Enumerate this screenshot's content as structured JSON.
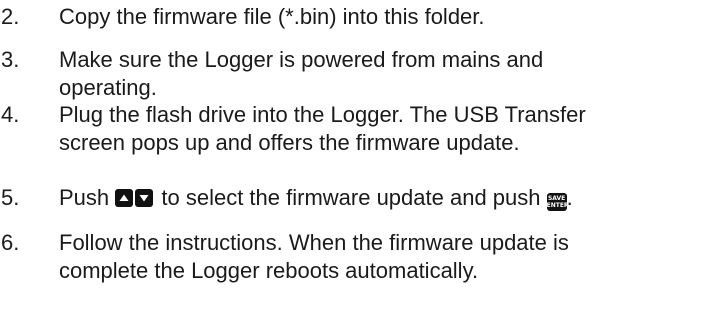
{
  "steps": [
    {
      "number": "2.",
      "lines": [
        "Copy the firmware file (*.bin) into this folder."
      ]
    },
    {
      "number": "3.",
      "lines": [
        "Make sure the Logger is powered from mains and",
        "operating."
      ]
    },
    {
      "number": "4.",
      "lines": [
        "Plug the flash drive into the Logger. The USB Transfer",
        "screen pops up and offers the firmware update."
      ]
    },
    {
      "number": "5.",
      "before": "Push ",
      "middle": " to select the firmware update and push ",
      "after": ".",
      "keys": {
        "up_icon": "up-arrow-key-icon",
        "down_icon": "down-arrow-key-icon",
        "enter_icon": "save-enter-key-icon",
        "enter_top": "SAVE",
        "enter_bottom": "ENTER"
      }
    },
    {
      "number": "6.",
      "lines": [
        "Follow the instructions. When the firmware update is",
        "complete the Logger reboots automatically."
      ]
    }
  ],
  "colors": {
    "text": "#1a1a1a",
    "key_background": "#111111",
    "key_foreground": "#ffffff"
  }
}
